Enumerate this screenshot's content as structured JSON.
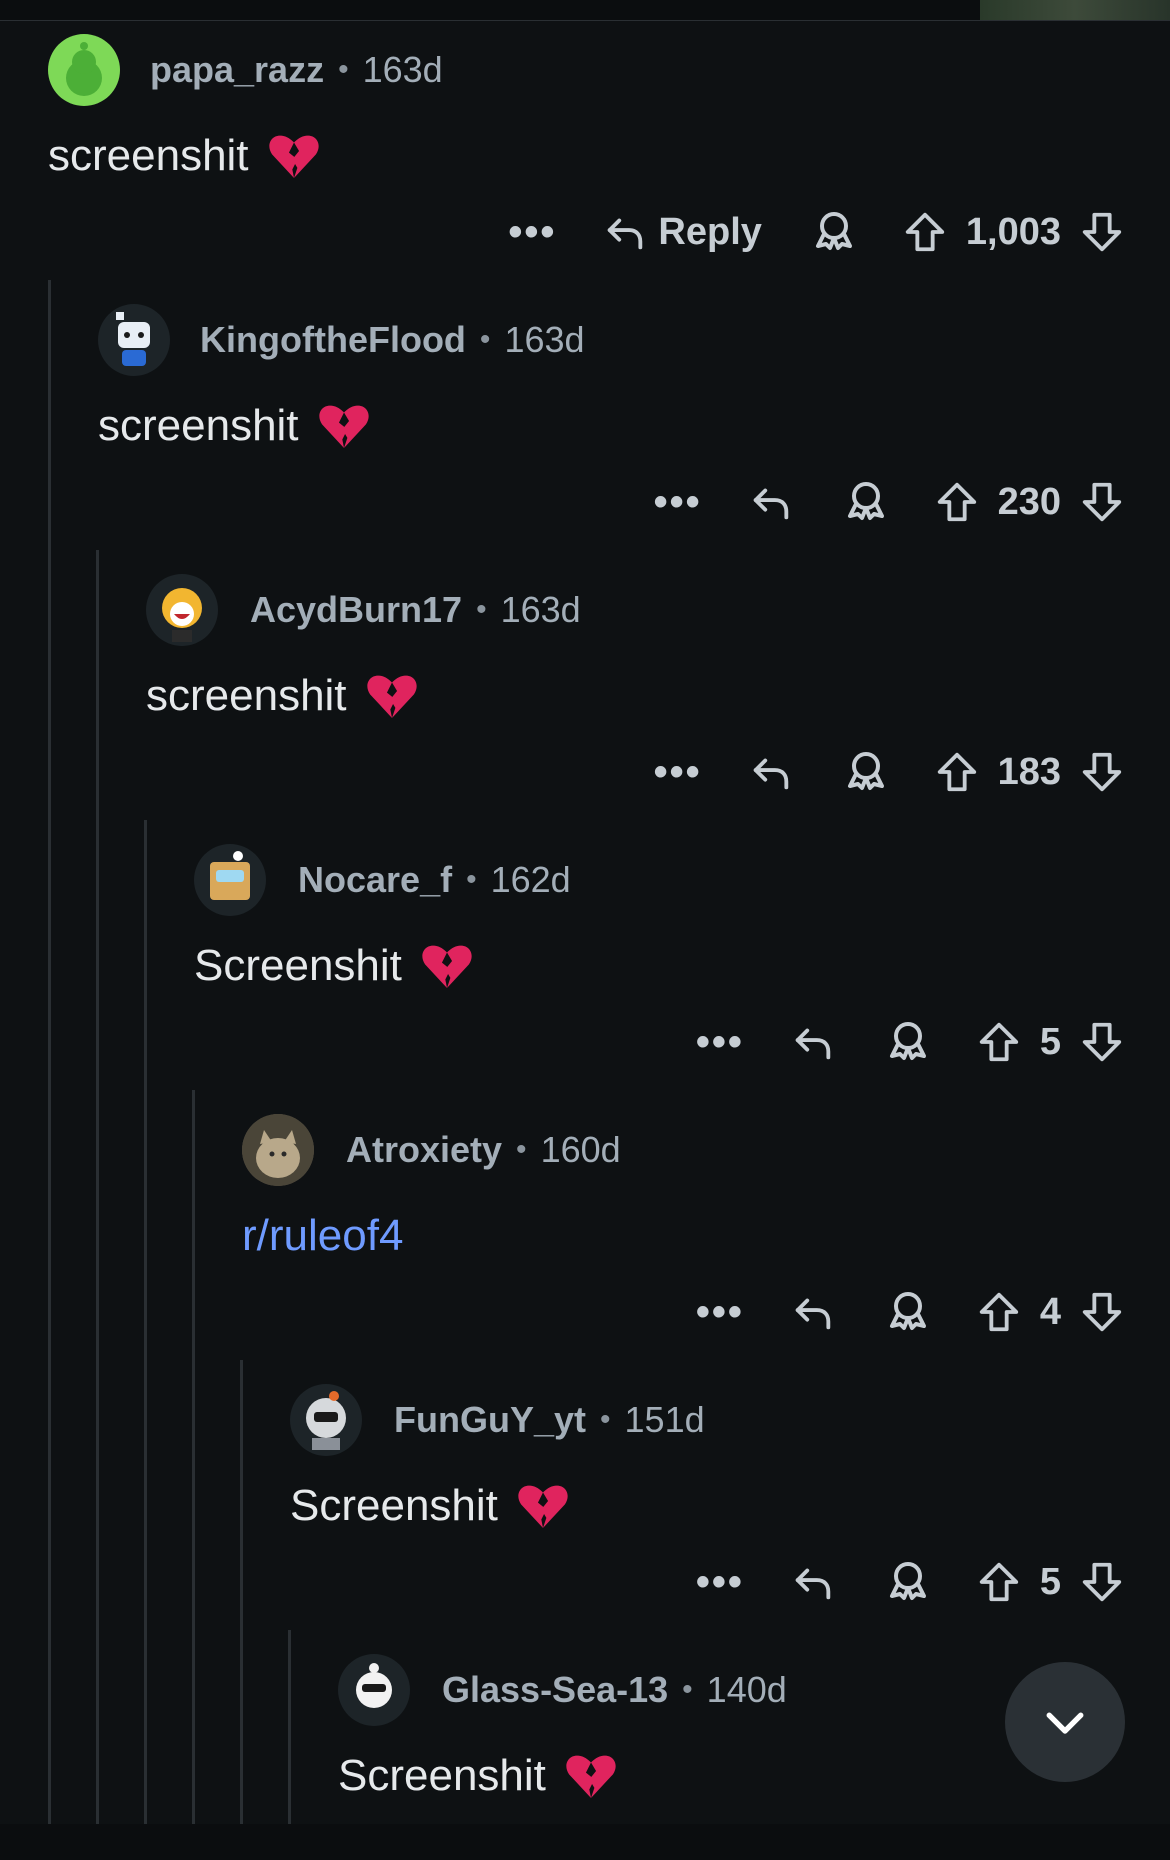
{
  "colors": {
    "background": "#0e1113",
    "username": "#a3aeb8",
    "body": "#e6e9eb",
    "link": "#6f9bff",
    "icon": "#c6cdd3",
    "thread_line": "#2a2f33"
  },
  "comments": [
    {
      "user": "papa_razz",
      "age": "163d",
      "text": "screenshit",
      "emoji": "broken-heart",
      "reply_label": "Reply",
      "score": "1,003",
      "avatar": "green-snoo-avatar"
    },
    {
      "user": "KingoftheFlood",
      "age": "163d",
      "text": "screenshit",
      "emoji": "broken-heart",
      "score": "230",
      "avatar": "robot-snoo-avatar"
    },
    {
      "user": "AcydBurn17",
      "age": "163d",
      "text": "screenshit",
      "emoji": "broken-heart",
      "score": "183",
      "avatar": "tiger-snoo-avatar"
    },
    {
      "user": "Nocare_f",
      "age": "162d",
      "text": "Screenshit",
      "emoji": "broken-heart",
      "score": "5",
      "avatar": "box-snoo-avatar"
    },
    {
      "user": "Atroxiety",
      "age": "160d",
      "link": "r/ruleof4",
      "score": "4",
      "avatar": "cat-photo-avatar"
    },
    {
      "user": "FunGuY_yt",
      "age": "151d",
      "text": "Screenshit",
      "emoji": "broken-heart",
      "score": "5",
      "avatar": "astronaut-snoo-avatar"
    },
    {
      "user": "Glass-Sea-13",
      "age": "140d",
      "text": "Screenshit",
      "emoji": "broken-heart",
      "avatar": "panda-snoo-avatar"
    }
  ],
  "ui": {
    "more_label": "•••",
    "separator": "•",
    "scroll_icon": "chevron-down-icon"
  }
}
